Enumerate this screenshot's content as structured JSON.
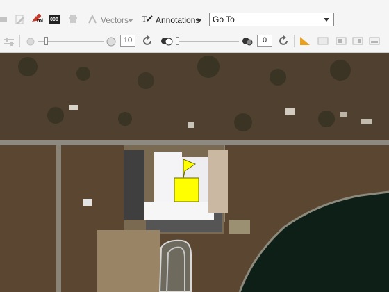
{
  "toolbar": {
    "vectors_label": "Vectors",
    "annotations_label": "Annotations",
    "goto_value": "Go To",
    "roi_badge": "roi",
    "tool_008": "008"
  },
  "slider1": {
    "value": "10"
  },
  "slider2": {
    "value": "0"
  },
  "icons": [
    "dim-icon",
    "edit-icon",
    "roi-tool-icon",
    "008-icon",
    "hand-icon",
    "vectors-icon",
    "annotations-icon",
    "sliders-icon",
    "brightness-low-icon",
    "brightness-high-icon",
    "refresh-icon",
    "contrast-low-icon",
    "contrast-high-icon",
    "refresh-icon",
    "measure-icon",
    "layer-icon",
    "overview-icon",
    "zoom-icon"
  ],
  "colors": {
    "toolbar_bg": "#f5f5f5",
    "annotation_flag": "#ffff00",
    "water": "#0e1f18"
  }
}
